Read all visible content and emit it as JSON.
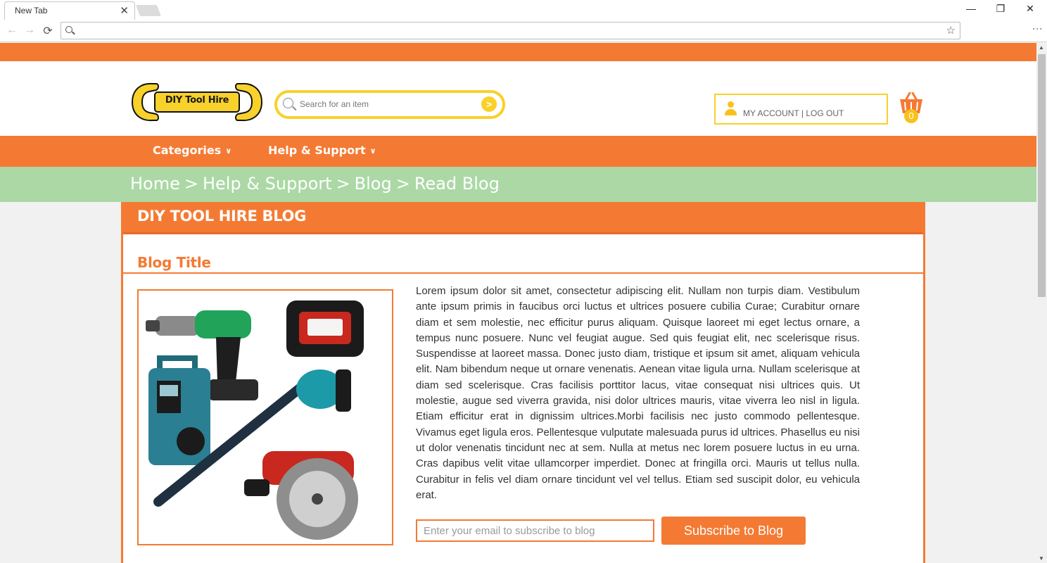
{
  "browser": {
    "tab_title": "New Tab",
    "tab_close": "✕",
    "back": "←",
    "forward": "→",
    "reload": "⟳",
    "star": "☆",
    "menu": "⋮",
    "window_minimize": "—",
    "window_restore": "❐",
    "window_close": "✕",
    "address_value": ""
  },
  "site": {
    "logo_text": "DIY Tool Hire",
    "search": {
      "placeholder": "Search for an item",
      "go": ">"
    },
    "account": {
      "label": "MY ACCOUNT | LOG OUT"
    },
    "cart": {
      "count": "0"
    },
    "colors": {
      "orange": "#f47a33",
      "yellow": "#f8d12a",
      "green": "#abd8a5"
    }
  },
  "nav": {
    "items": [
      {
        "label": "Categories",
        "chevron": "∨"
      },
      {
        "label": "Help & Support",
        "chevron": "∨"
      }
    ]
  },
  "breadcrumb": {
    "items": [
      "Home",
      "Help & Support",
      "Blog",
      "Read Blog"
    ],
    "separator": ">"
  },
  "blog": {
    "header": "DIY TOOL HIRE BLOG",
    "title": "Blog Title",
    "image_alt": "Power tools: drill, work light, radio, blower, circular saw",
    "body": "Lorem ipsum dolor sit amet, consectetur adipiscing elit. Nullam non turpis diam. Vestibulum ante ipsum primis in faucibus orci luctus et ultrices posuere cubilia Curae; Curabitur ornare diam et sem molestie, nec efficitur purus aliquam. Quisque laoreet mi eget lectus ornare, a tempus nunc posuere. Nunc vel feugiat augue. Sed quis feugiat elit, nec scelerisque risus. Suspendisse at laoreet massa. Donec justo diam, tristique et ipsum sit amet, aliquam vehicula elit. Nam bibendum neque ut ornare venenatis. Aenean vitae ligula urna. Nullam scelerisque at diam sed scelerisque. Cras facilisis porttitor lacus, vitae consequat nisi ultrices quis. Ut molestie, augue sed viverra gravida, nisi dolor ultrices mauris, vitae viverra leo nisl in ligula. Etiam efficitur erat in dignissim ultrices.Morbi facilisis nec justo commodo pellentesque. Vivamus eget ligula eros. Pellentesque vulputate malesuada purus id ultrices. Phasellus eu nisi ut dolor venenatis tincidunt nec at sem. Nulla at metus nec lorem posuere luctus in eu urna. Cras dapibus velit vitae ullamcorper imperdiet. Donec at fringilla orci. Mauris ut tellus nulla. Curabitur in felis vel diam ornare tincidunt vel vel tellus. Etiam sed suscipit dolor, eu vehicula erat.",
    "subscribe": {
      "email_placeholder": "Enter your email to subscribe to blog",
      "button_label": "Subscribe to Blog"
    }
  }
}
